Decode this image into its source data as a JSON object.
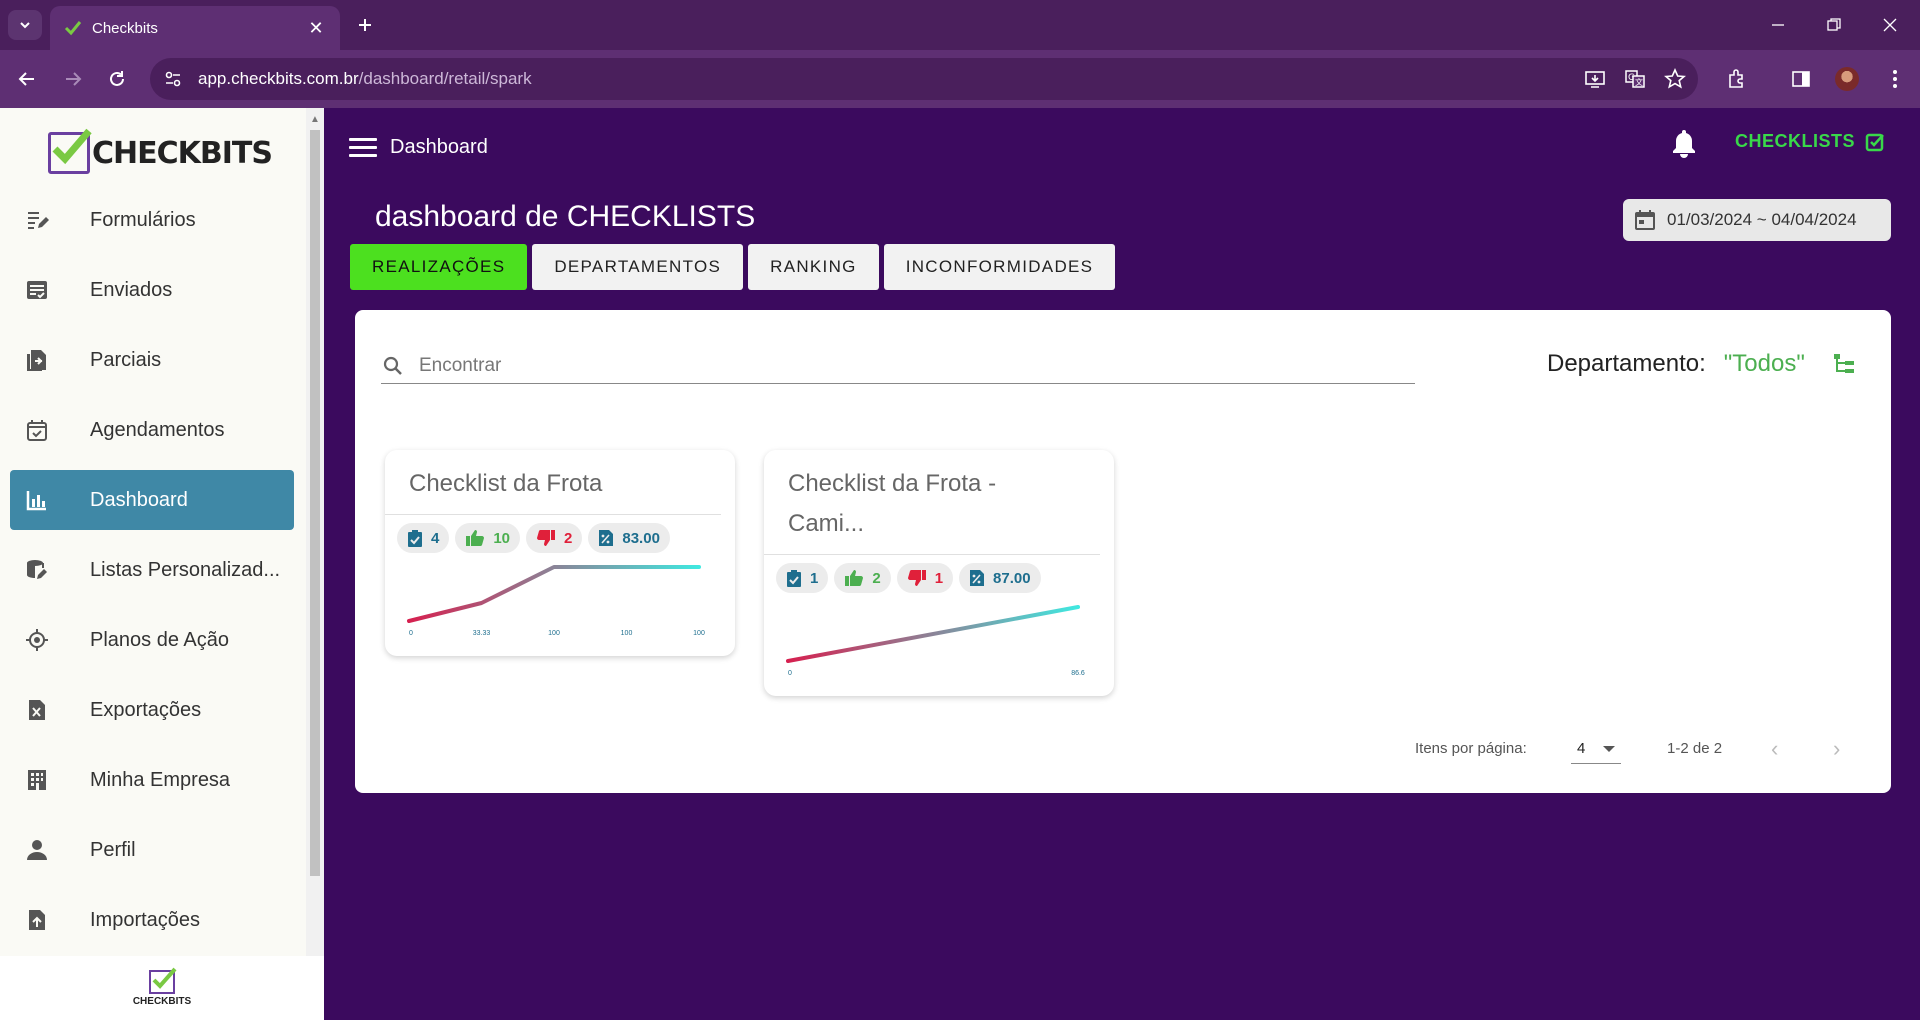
{
  "browser": {
    "tab_title": "Checkbits",
    "url_host": "app.checkbits.com.br",
    "url_path": "/dashboard/retail/spark"
  },
  "sidebar": {
    "logo_text": "CHECKBITS",
    "footer_logo_text": "CHECKBITS",
    "items": [
      {
        "label": "Formulários",
        "icon": "form-edit-icon"
      },
      {
        "label": "Enviados",
        "icon": "sent-list-icon"
      },
      {
        "label": "Parciais",
        "icon": "partial-docs-icon"
      },
      {
        "label": "Agendamentos",
        "icon": "calendar-check-icon"
      },
      {
        "label": "Dashboard",
        "icon": "bar-chart-icon",
        "active": true
      },
      {
        "label": "Listas Personalizad...",
        "icon": "database-edit-icon"
      },
      {
        "label": "Planos de Ação",
        "icon": "crosshair-icon"
      },
      {
        "label": "Exportações",
        "icon": "excel-export-icon"
      },
      {
        "label": "Minha Empresa",
        "icon": "building-icon"
      },
      {
        "label": "Perfil",
        "icon": "person-icon"
      },
      {
        "label": "Importações",
        "icon": "file-upload-icon"
      }
    ]
  },
  "header": {
    "title": "Dashboard",
    "checklists_link": "CHECKLISTS"
  },
  "page": {
    "title": "dashboard de CHECKLISTS",
    "date_range": "01/03/2024 ~ 04/04/2024",
    "tabs": [
      {
        "label": "REALIZAÇÕES",
        "active": true
      },
      {
        "label": "DEPARTAMENTOS"
      },
      {
        "label": "RANKING"
      },
      {
        "label": "INCONFORMIDADES"
      }
    ],
    "search_placeholder": "Encontrar",
    "department_label": "Departamento:",
    "department_value": "\"Todos\""
  },
  "cards": [
    {
      "title": "Checklist da Frota",
      "count": "4",
      "likes": "10",
      "dislikes": "2",
      "percent": "83.00"
    },
    {
      "title": "Checklist da Frota - Cami...",
      "count": "1",
      "likes": "2",
      "dislikes": "1",
      "percent": "87.00"
    }
  ],
  "chart_data": [
    {
      "type": "line",
      "x": [
        "0",
        "33.33",
        "100",
        "100",
        "100"
      ],
      "series": [
        {
          "values": [
            0,
            33.33,
            100,
            100,
            100
          ]
        }
      ],
      "ylim": [
        0,
        100
      ]
    },
    {
      "type": "line",
      "x": [
        "0",
        "86.6"
      ],
      "series": [
        {
          "values": [
            0,
            86.6
          ]
        }
      ],
      "ylim": [
        0,
        86.6
      ]
    }
  ],
  "pager": {
    "items_label": "Itens por página:",
    "page_size": "4",
    "range": "1-2 de 2"
  },
  "colors": {
    "brand_purple": "#3b0a5e",
    "active_tab_green": "#4ce01f",
    "sidebar_active": "#3f88a6",
    "spark_start": "#d6204f",
    "spark_end": "#40e8e0"
  }
}
